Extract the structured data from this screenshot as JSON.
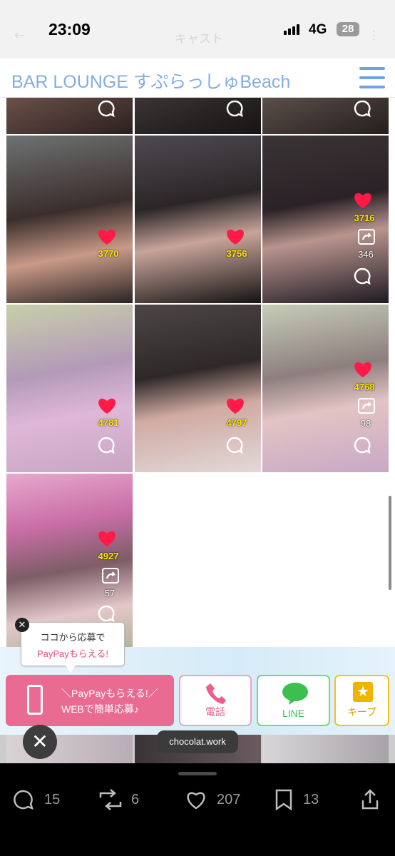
{
  "status_bar": {
    "time": "23:09",
    "network": "4G",
    "battery": "28",
    "faint_title": "キャスト"
  },
  "site": {
    "title": "BAR LOUNGE すぷらっしゅBeach"
  },
  "posts": [
    {
      "likes": "3770",
      "retweets": ""
    },
    {
      "likes": "3756",
      "retweets": ""
    },
    {
      "likes": "3716",
      "retweets": "346"
    },
    {
      "likes": "4781",
      "retweets": ""
    },
    {
      "likes": "4797",
      "retweets": ""
    },
    {
      "likes": "4768",
      "retweets": "98"
    },
    {
      "likes": "4927",
      "retweets": "57"
    }
  ],
  "tooltip": {
    "line1": "ココから応募で",
    "line2": "PayPayもらえる!"
  },
  "apply_button": {
    "line1": "＼PayPayもらえる!／",
    "line2": "WEBで簡単応募♪"
  },
  "buttons": {
    "call": "電話",
    "line": "LINE",
    "keep": "キープ"
  },
  "overlay": {
    "source": "chocolat.work"
  },
  "actions": {
    "replies": "15",
    "retweets": "6",
    "likes": "207",
    "bookmarks": "13"
  },
  "colors": {
    "accent_blue": "#84aee0",
    "pink": "#e96b92",
    "line_green": "#3bbf4e",
    "keep_gold": "#f0b400"
  },
  "icons": [
    "hamburger-menu-icon",
    "heart-icon",
    "retweet-icon",
    "comment-icon",
    "phone-icon",
    "line-icon",
    "star-icon",
    "close-icon",
    "share-icon",
    "bookmark-icon"
  ]
}
